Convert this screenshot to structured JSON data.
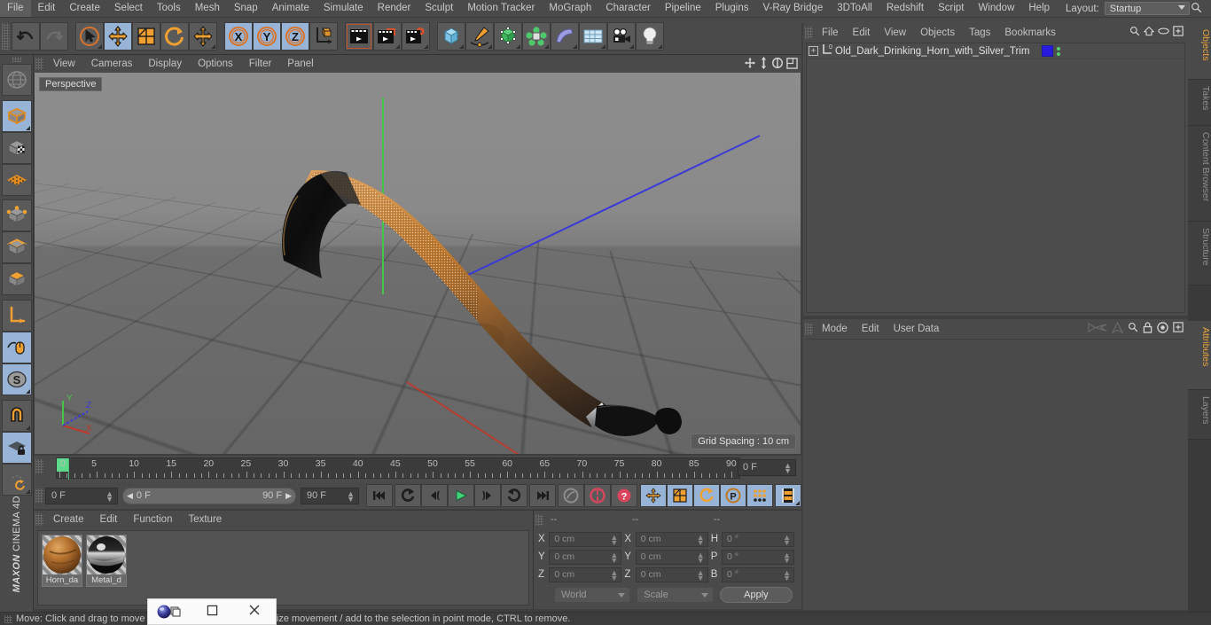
{
  "menubar": {
    "items": [
      "File",
      "Edit",
      "Create",
      "Select",
      "Tools",
      "Mesh",
      "Snap",
      "Animate",
      "Simulate",
      "Render",
      "Sculpt",
      "Motion Tracker",
      "MoGraph",
      "Character",
      "Pipeline",
      "Plugins",
      "V-Ray Bridge",
      "3DToAll",
      "Redshift",
      "Script",
      "Window",
      "Help"
    ],
    "layout_label": "Layout:",
    "layout_value": "Startup",
    "search_icon": "search-icon"
  },
  "toolbar": {
    "groups": [
      {
        "name": "history",
        "buttons": [
          {
            "icon": "undo-icon",
            "active": false,
            "corner": false
          },
          {
            "icon": "redo-icon",
            "active": false,
            "corner": false
          }
        ]
      },
      {
        "name": "tools",
        "buttons": [
          {
            "icon": "live-selection-icon",
            "active": false,
            "corner": true
          },
          {
            "icon": "move-tool-icon",
            "active": true,
            "corner": false
          },
          {
            "icon": "scale-tool-icon",
            "active": false,
            "corner": false
          },
          {
            "icon": "rotate-tool-icon",
            "active": false,
            "corner": false
          },
          {
            "icon": "move-alt-icon",
            "active": false,
            "corner": true
          }
        ]
      },
      {
        "name": "axis-locks",
        "buttons": [
          {
            "icon": "x-axis-icon",
            "active": true,
            "corner": false
          },
          {
            "icon": "y-axis-icon",
            "active": true,
            "corner": false
          },
          {
            "icon": "z-axis-icon",
            "active": true,
            "corner": false
          },
          {
            "icon": "world-coordinates-icon",
            "active": false,
            "corner": false
          }
        ]
      },
      {
        "name": "render",
        "buttons": [
          {
            "icon": "render-view-icon",
            "active": false,
            "corner": false
          },
          {
            "icon": "render-region-icon",
            "active": false,
            "corner": true
          },
          {
            "icon": "render-settings-icon",
            "active": false,
            "corner": true
          }
        ]
      },
      {
        "name": "objects",
        "buttons": [
          {
            "icon": "cube-primitive-icon",
            "active": false,
            "corner": true
          },
          {
            "icon": "spline-pen-icon",
            "active": false,
            "corner": true
          },
          {
            "icon": "generator-icon",
            "active": false,
            "corner": true
          },
          {
            "icon": "deformer-icon",
            "active": false,
            "corner": true
          },
          {
            "icon": "environment-icon",
            "active": false,
            "corner": true
          },
          {
            "icon": "scene-icon",
            "active": false,
            "corner": true
          },
          {
            "icon": "camera-icon",
            "active": false,
            "corner": true
          },
          {
            "icon": "light-icon",
            "active": false,
            "corner": true
          }
        ]
      }
    ]
  },
  "left_palette": {
    "buttons": [
      {
        "icon": "globe-mode-icon",
        "active": false,
        "corner": false
      },
      {
        "icon": "model-mode-icon",
        "active": true,
        "corner": true
      },
      {
        "icon": "texture-mode-icon",
        "active": false,
        "corner": false
      },
      {
        "icon": "workplane-mode-icon",
        "active": false,
        "corner": false
      },
      {
        "icon": "points-mode-icon",
        "active": false,
        "corner": false
      },
      {
        "icon": "edges-mode-icon",
        "active": false,
        "corner": false
      },
      {
        "icon": "polygons-mode-icon",
        "active": false,
        "corner": false
      },
      {
        "icon": "axis-mode-icon",
        "active": false,
        "corner": false
      },
      {
        "icon": "viewport-solo-icon",
        "active": true,
        "corner": false
      },
      {
        "icon": "scale-snap-icon",
        "active": true,
        "corner": true
      },
      {
        "icon": "magnet-icon",
        "active": false,
        "corner": true
      },
      {
        "icon": "workplane-lock-icon",
        "active": true,
        "corner": false
      },
      {
        "icon": "workplane-reset-icon",
        "active": false,
        "corner": true
      }
    ],
    "brand_top": "MAXON",
    "brand_bottom": "CINEMA 4D"
  },
  "viewport": {
    "menu_items": [
      "View",
      "Cameras",
      "Display",
      "Options",
      "Filter",
      "Panel"
    ],
    "corner_icons": [
      "pan-view-icon",
      "zoom-view-icon",
      "rotate-view-icon",
      "maximize-view-icon"
    ],
    "label": "Perspective",
    "grid_spacing": "Grid Spacing : 10 cm",
    "gizmo": {
      "x": "X",
      "y": "Y",
      "z": "Z"
    },
    "model_name": "drinking-horn-model"
  },
  "timeline": {
    "ticks": [
      {
        "label": "0",
        "pos": 0
      },
      {
        "label": "5",
        "pos": 5
      },
      {
        "label": "10",
        "pos": 10
      },
      {
        "label": "15",
        "pos": 15
      },
      {
        "label": "20",
        "pos": 20
      },
      {
        "label": "25",
        "pos": 25
      },
      {
        "label": "30",
        "pos": 30
      },
      {
        "label": "35",
        "pos": 35
      },
      {
        "label": "40",
        "pos": 40
      },
      {
        "label": "45",
        "pos": 45
      },
      {
        "label": "50",
        "pos": 50
      },
      {
        "label": "55",
        "pos": 55
      },
      {
        "label": "60",
        "pos": 60
      },
      {
        "label": "65",
        "pos": 65
      },
      {
        "label": "70",
        "pos": 70
      },
      {
        "label": "75",
        "pos": 75
      },
      {
        "label": "80",
        "pos": 80
      },
      {
        "label": "85",
        "pos": 85
      },
      {
        "label": "90",
        "pos": 90
      }
    ],
    "range_min": 0,
    "range_max": 90,
    "current_frame_field": "0 F",
    "start_field": "0 F",
    "range_start": "0 F",
    "range_end": "90 F",
    "end_field": "90 F",
    "transport": [
      {
        "icon": "go-to-start-icon",
        "active": false,
        "corner": false
      },
      {
        "icon": "previous-key-icon",
        "active": false,
        "corner": false
      },
      {
        "icon": "step-back-icon",
        "active": false,
        "corner": false
      },
      {
        "icon": "play-icon",
        "active": false,
        "corner": false
      },
      {
        "icon": "step-forward-icon",
        "active": false,
        "corner": false
      },
      {
        "icon": "next-key-icon",
        "active": false,
        "corner": false
      },
      {
        "icon": "go-to-end-icon",
        "active": false,
        "corner": false
      }
    ],
    "record_tools": [
      {
        "icon": "autokey-icon",
        "active": false,
        "corner": false
      },
      {
        "icon": "record-active-objects-icon",
        "active": false,
        "corner": false
      },
      {
        "icon": "record-keyframe-icon",
        "active": false,
        "corner": false
      }
    ],
    "key_filters": [
      {
        "icon": "position-key-icon",
        "active": true,
        "corner": false
      },
      {
        "icon": "scale-key-icon",
        "active": true,
        "corner": false
      },
      {
        "icon": "rotation-key-icon",
        "active": true,
        "corner": false
      },
      {
        "icon": "parameter-key-icon",
        "active": true,
        "corner": false
      },
      {
        "icon": "point-level-animation-icon",
        "active": true,
        "corner": false
      }
    ],
    "timeline_toggle": {
      "icon": "timeline-toggle-icon",
      "active": true,
      "corner": true
    }
  },
  "material_manager": {
    "menu_items": [
      "Create",
      "Edit",
      "Function",
      "Texture"
    ],
    "materials": [
      {
        "name": "Horn_da",
        "full_name": "Horn_dark",
        "swatch": "#b06a2c"
      },
      {
        "name": "Metal_d",
        "full_name": "Metal_dark",
        "swatch": "#9a9a9a"
      }
    ]
  },
  "coordinates": {
    "headers": [
      "--",
      "--",
      "--"
    ],
    "position": [
      {
        "axis": "X",
        "value": "0 cm"
      },
      {
        "axis": "Y",
        "value": "0 cm"
      },
      {
        "axis": "Z",
        "value": "0 cm"
      }
    ],
    "size": [
      {
        "axis": "X",
        "value": "0 cm"
      },
      {
        "axis": "Y",
        "value": "0 cm"
      },
      {
        "axis": "Z",
        "value": "0 cm"
      }
    ],
    "rotation": [
      {
        "axis": "H",
        "value": "0 °"
      },
      {
        "axis": "P",
        "value": "0 °"
      },
      {
        "axis": "B",
        "value": "0 °"
      }
    ],
    "system_dropdown": "World",
    "mode_dropdown": "Scale",
    "apply_button": "Apply"
  },
  "object_manager": {
    "menu_items": [
      "File",
      "Edit",
      "View",
      "Objects",
      "Tags",
      "Bookmarks"
    ],
    "icons": [
      "search-icon",
      "home-icon",
      "eye-icon",
      "add-layer-icon"
    ],
    "objects": [
      {
        "name": "Old_Dark_Drinking_Horn_with_Silver_Trim",
        "expand": "+",
        "layer_color": "#2a1ae0"
      }
    ]
  },
  "attribute_manager": {
    "menu_items": [
      "Mode",
      "Edit",
      "User Data"
    ],
    "icons": [
      "back-nav-icon",
      "forward-nav-icon",
      "search-icon",
      "lock-icon",
      "target-icon",
      "add-tab-icon"
    ]
  },
  "right_tabs": {
    "top": [
      {
        "label": "Objects",
        "selected": true
      },
      {
        "label": "Takes",
        "selected": false
      },
      {
        "label": "Content Browser",
        "selected": false
      },
      {
        "label": "Structure",
        "selected": false
      }
    ],
    "bottom": [
      {
        "label": "Attributes",
        "selected": true
      },
      {
        "label": "Layers",
        "selected": false
      }
    ]
  },
  "statusbar": {
    "text": "Move: Click and drag to move the selection / SHIFT to quantize movement / add to the selection in point mode, CTRL to remove."
  },
  "popup_window": {
    "restore_icon": "restore-window-icon",
    "minimize_icon": "minimize-window-icon",
    "close_icon": "close-window-icon"
  },
  "colors": {
    "panel_bg": "#4a4a4a",
    "app_bg": "#3f3f3f",
    "accent_blue": "#97b4d6",
    "accent_orange": "#e8a33d",
    "axis_x": "#c0392b",
    "axis_y": "#49c24a",
    "axis_z": "#3a3ad8"
  }
}
